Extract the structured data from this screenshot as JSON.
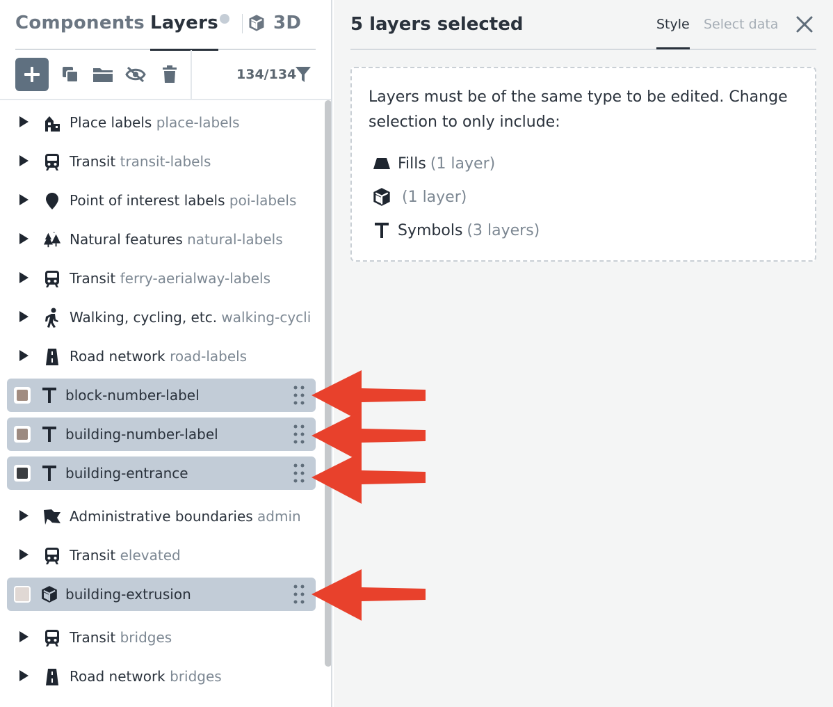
{
  "left_panel": {
    "tabs": {
      "components": "Components",
      "layers": "Layers",
      "three_d": "3D"
    },
    "layer_count": "134/134",
    "layers": [
      {
        "name": "Place labels",
        "id": "place-labels",
        "icon": "place-labels-icon"
      },
      {
        "name": "Transit",
        "id": "transit-labels",
        "icon": "transit-icon"
      },
      {
        "name": "Point of interest labels",
        "id": "poi-labels",
        "icon": "map-pin-icon"
      },
      {
        "name": "Natural features",
        "id": "natural-labels",
        "icon": "trees-icon"
      },
      {
        "name": "Transit",
        "id": "ferry-aerialway-labels",
        "icon": "transit-icon"
      },
      {
        "name": "Walking, cycling, etc.",
        "id": "walking-cycling-labels",
        "icon": "walking-icon"
      },
      {
        "name": "Road network",
        "id": "road-labels",
        "icon": "road-icon"
      }
    ],
    "selected_group": [
      {
        "name": "block-number-label",
        "icon": "text-symbol-icon",
        "swatch": "#a18c80"
      },
      {
        "name": "building-number-label",
        "icon": "text-symbol-icon",
        "swatch": "#9c8a80"
      },
      {
        "name": "building-entrance",
        "icon": "text-symbol-icon",
        "swatch": "#3a3d40"
      }
    ],
    "layers_after": [
      {
        "name": "Administrative boundaries",
        "id": "admin",
        "icon": "flag-icon"
      },
      {
        "name": "Transit",
        "id": "elevated",
        "icon": "transit-icon"
      }
    ],
    "selected_single": {
      "name": "building-extrusion",
      "icon": "cube-icon",
      "swatch": "#e0d8d4"
    },
    "layers_end": [
      {
        "name": "Transit",
        "id": "bridges",
        "icon": "transit-icon"
      },
      {
        "name": "Road network",
        "id": "bridges",
        "icon": "road-icon"
      }
    ]
  },
  "right_panel": {
    "title": "5 layers selected",
    "tab_style": "Style",
    "tab_select_data": "Select data",
    "message": "Layers must be of the same type to be edited. Change selection to only include:",
    "options": [
      {
        "label": "Fills",
        "count": "(1 layer)",
        "icon": "fill-icon"
      },
      {
        "label": "",
        "count": "(1 layer)",
        "icon": "cube-icon"
      },
      {
        "label": "Symbols",
        "count": "(3 layers)",
        "icon": "text-symbol-icon"
      }
    ]
  },
  "colors": {
    "selected_row": "#c2ccd7",
    "annotation_arrow": "#e8412c"
  }
}
